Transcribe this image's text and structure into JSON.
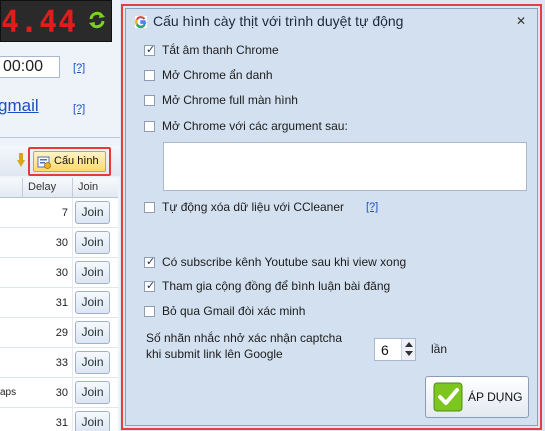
{
  "background_app": {
    "counter_value": "4.44",
    "time_value": "00:00",
    "help_link": "[?]",
    "gmail_link": "gmail",
    "config_button_label": "Cấu hình",
    "grid": {
      "headers": [
        "Delay",
        "Join"
      ],
      "rows": [
        {
          "name": "",
          "delay": "7",
          "join": "Join"
        },
        {
          "name": "",
          "delay": "30",
          "join": "Join"
        },
        {
          "name": "",
          "delay": "30",
          "join": "Join"
        },
        {
          "name": "",
          "delay": "31",
          "join": "Join"
        },
        {
          "name": "",
          "delay": "29",
          "join": "Join"
        },
        {
          "name": "",
          "delay": "33",
          "join": "Join"
        },
        {
          "name": "aps",
          "delay": "30",
          "join": "Join"
        },
        {
          "name": "",
          "delay": "31",
          "join": "Join"
        }
      ]
    }
  },
  "dialog": {
    "title": "Cấu hình cày thịt với trình duyệt tự động",
    "close_label": "✕",
    "options": [
      {
        "label": "Tắt âm thanh Chrome",
        "checked": true
      },
      {
        "label": "Mở Chrome ẩn danh",
        "checked": false
      },
      {
        "label": "Mở Chrome full màn hình",
        "checked": false
      },
      {
        "label": "Mở Chrome với các argument sau:",
        "checked": false
      },
      {
        "label": "Tự động xóa dữ liệu với CCleaner",
        "checked": false
      },
      {
        "label": "Có subscribe kênh Youtube sau khi view xong",
        "checked": true
      },
      {
        "label": "Tham gia cộng đồng để bình luận bài đăng",
        "checked": true
      },
      {
        "label": "Bỏ qua Gmail đòi xác minh",
        "checked": false
      }
    ],
    "arguments_value": "",
    "ccleaner_help": "[?]",
    "captcha_label_line1": "Số nhãn nhắc nhở xác nhận captcha",
    "captcha_label_line2": "khi submit link lên Google",
    "captcha_count": "6",
    "captcha_unit": "lần",
    "apply_label": "ÁP DỤNG"
  },
  "colors": {
    "highlight": "#e04040",
    "counter_digits": "#e21b1b",
    "dialog_bg": "#d3e0f0",
    "link": "#1a4fc4"
  }
}
